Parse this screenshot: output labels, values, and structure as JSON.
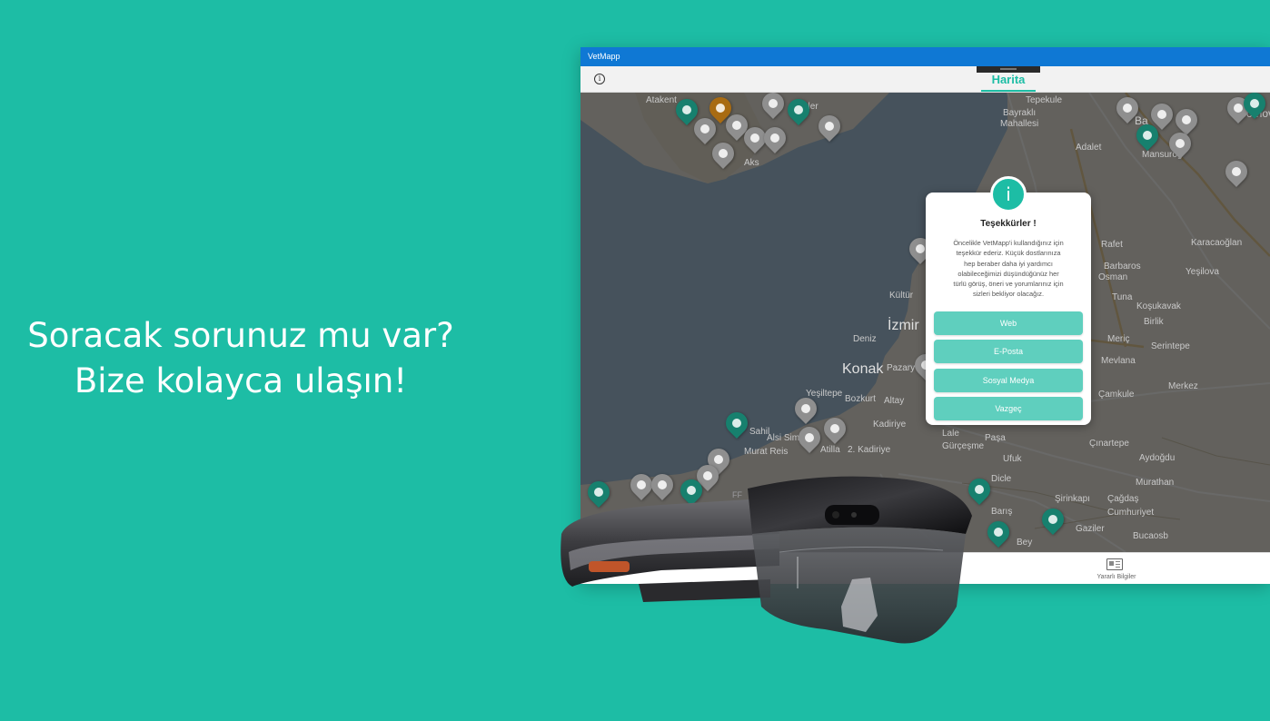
{
  "promo": {
    "line1": "Soracak sorunuz mu var?",
    "line2": "Bize kolayca ulaşın!"
  },
  "app": {
    "window_title": "VetMapp",
    "info_icon_glyph": "i",
    "tab_title": "Harita",
    "bottom_item_label": "Yararlı Bilgiler",
    "bottom_item_icon": "newspaper-icon"
  },
  "map": {
    "labels": {
      "atakent": "Atakent",
      "evler": "evler",
      "tepekule": "Tepekule",
      "bayrakli": "Bayraklı",
      "mahallesi": "Mahallesi",
      "adalet": "Adalet",
      "mansuroglu": "Mansuroğ",
      "aks": "Aks",
      "izmir": "İzmir",
      "denizli": "Deniz",
      "kultur": "Kültür",
      "konak": "Konak",
      "pazary": "Pazary",
      "bozkurt": "Bozkurt",
      "altay": "Altay",
      "kadiriye": "Kadiriye",
      "sahil": "Sahil",
      "yesiltepe": "Yeşiltepe",
      "alsimav": "Alsi Simav",
      "murat_reis": "Murat Reis",
      "atilla": "Atilla",
      "kadiriye2": "2. Kadiriye",
      "lale": "Lale",
      "gurcesme": "Gürçeşme",
      "pasa": "Paşa",
      "ufuk": "Ufuk",
      "dicle": "Dicle",
      "baris": "Barış",
      "bey": "Bey",
      "gaziler": "Gaziler",
      "sirinkapi": "Şirinkapı",
      "cagdas": "Çağdaş",
      "cumhuriyet": "Cumhuriyet",
      "bucaosb": "Bucaosb",
      "murathan": "Murathan",
      "aydogdu": "Aydoğdu",
      "cinartepe": "Çınartepe",
      "camkule": "Çamkule",
      "merkez": "Merkez",
      "mevlana": "Mevlana",
      "serintepe": "Serintepe",
      "meric": "Meriç",
      "birlik": "Birlik",
      "kosukavak": "Koşukavak",
      "yesilova": "Yeşilova",
      "karacaoglan": "Karacaoğlan",
      "rafet": "Rafet",
      "barbaros": "Barbaros",
      "osman": "Osman",
      "tuna": "Tuna",
      "bornova": "Bornova",
      "ba": "Ba"
    }
  },
  "dialog": {
    "icon": "info-icon",
    "icon_glyph": "i",
    "title": "Teşekkürler !",
    "body_lines": [
      "Öncelikle VetMapp'i kullandığınız için",
      "teşekkür ederiz. Küçük dostlarınıza",
      "hep beraber daha iyi yardımcı",
      "olabileceğimizi düşündüğünüz her",
      "türlü görüş, öneri ve yorumlarınız için",
      "sizleri bekliyor olacağız."
    ],
    "buttons": [
      "Web",
      "E-Posta",
      "Sosyal Medya",
      "Vazgeç"
    ]
  },
  "colors": {
    "background": "#1dbda5",
    "accent": "#1dbda5",
    "button": "#5fcfbe",
    "titlebar": "#0f78d4",
    "pin_green": "#17806e",
    "pin_grey": "#8f8f8f",
    "pin_orange": "#a86b12"
  },
  "headset": {
    "image": "hololens-headset-image",
    "logo_text": "FF"
  }
}
